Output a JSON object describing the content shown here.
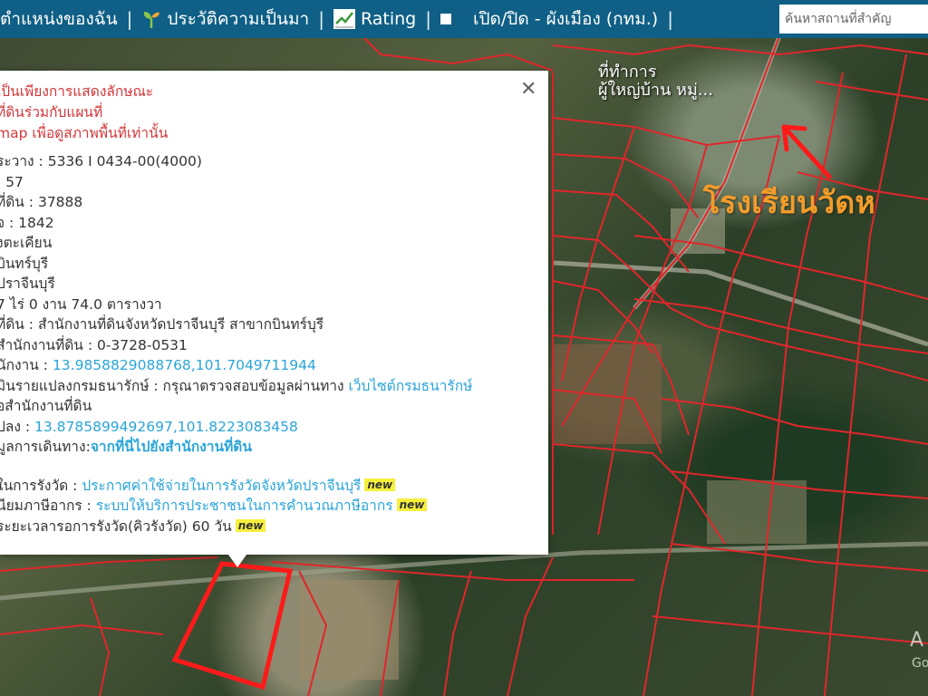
{
  "topbar": {
    "my_location": "ตำแหน่งของฉัน",
    "history": "ประวัติความเป็นมา",
    "rating": "Rating",
    "toggle_city_plan": "เปิด/ปิด - ผังเมือง (กทม.)",
    "search_placeholder": "ค้นหาสถานที่สำคัญ"
  },
  "popup": {
    "warning": [
      "เป็นเพียงการแสดงลักษณะ",
      "ที่ดินร่วมกับแผนที่",
      "map เพื่อดูสภาพพื้นที่เท่านั้น"
    ],
    "lines": {
      "l1": "ระวาง : 5336 I 0434-00(4000)",
      "l2": ": 57",
      "l3": "ที่ดิน : 37888",
      "l4": "จ : 1842",
      "l5": "งตะเคียน",
      "l6": "บินทร์บุรี",
      "l7": "ปราจีนบุรี",
      "l8": "7 ไร่ 0 งาน 74.0 ตารางวา",
      "l9": "ที่ดิน : สำนักงานที่ดินจังหวัดปราจีนบุรี สาขากบินทร์บุรี",
      "l10": "สำนักงานที่ดิน : 0-3728-0531",
      "l11_label": "นักงาน : ",
      "l11_link": "13.9858829088768,101.7049711944",
      "l12_label": "มินรายแปลงกรมธนารักษ์ : กรุณาตรวจสอบข้อมูลผ่านทาง ",
      "l12_link": "เว็บไซต์กรมธนารักษ์",
      "l13": "อสำนักงานที่ดิน",
      "l14_label": "ปลง : ",
      "l14_link": "13.8785899492697,101.8223083458",
      "l15_label": "มูลการเดินทาง:",
      "l15_link": "จากที่นี่ไปยังสำนักงานที่ดิน",
      "l16_label": "ในการรังวัด : ",
      "l16_link": "ประกาศค่าใช้จ่ายในการรังวัดจังหวัดปราจีนบุรี",
      "l17_label": "นียมภาษีอากร : ",
      "l17_link": "ระบบให้บริการประชาชนในการคำนวณภาษีอากร",
      "l18": "ระยะเวลารอการรังวัด(คิวรังวัด) 60 วัน",
      "new_badge": "new"
    }
  },
  "map": {
    "school_label": "โรงเรียนวัดห",
    "office_label_1": "ที่ทำการ",
    "office_label_2": "ผู้ใหญ่บ้าน หมู่...",
    "watermark_1": "A",
    "watermark_2": "Go"
  },
  "colors": {
    "topbar": "#0f5f86",
    "parcel_lines": "#e0262b",
    "warning_text": "#d3363a",
    "link": "#2aa5d9",
    "school_label": "#f39c2a"
  }
}
